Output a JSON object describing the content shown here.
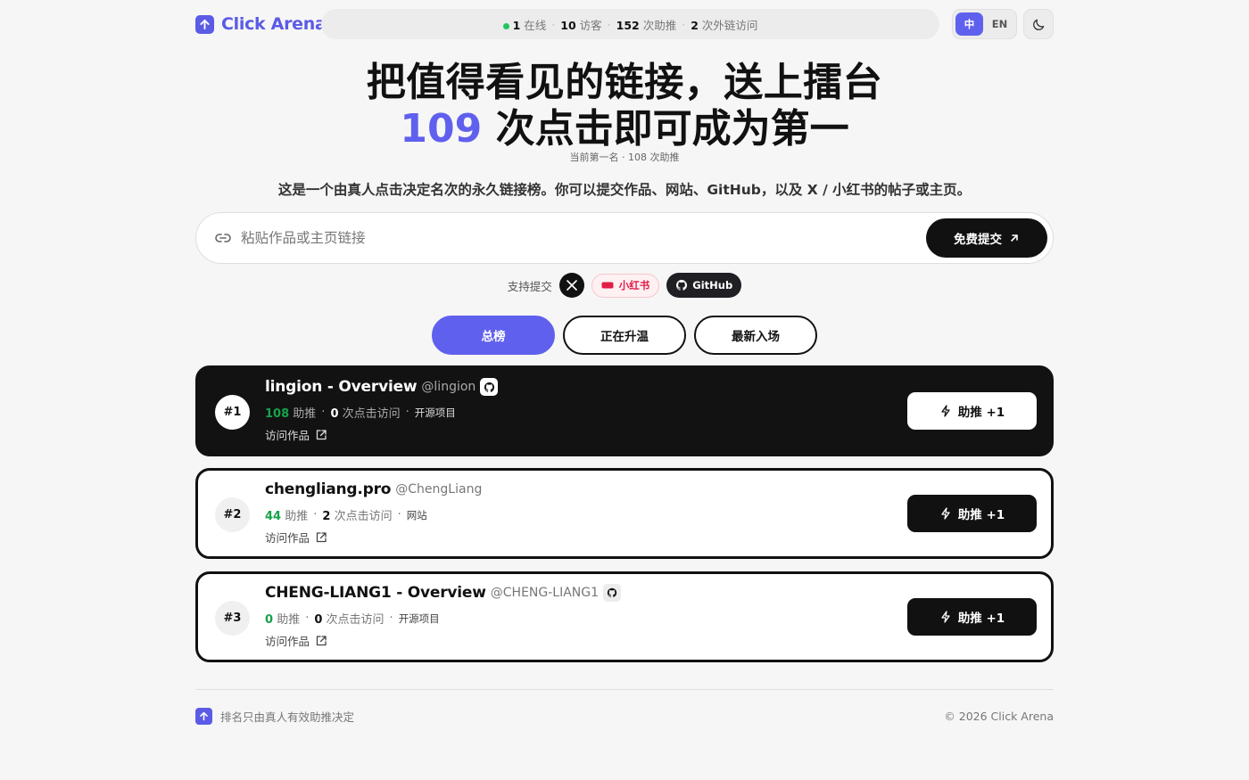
{
  "header": {
    "brand": "Click Arena",
    "stats": {
      "online_num": "1",
      "online_label": "在线",
      "visitors_num": "10",
      "visitors_label": "访客",
      "boosts_num": "152",
      "boosts_label": "次助推",
      "outbound_num": "2",
      "outbound_label": "次外链访问"
    },
    "lang": {
      "zh": "中",
      "en": "EN"
    }
  },
  "hero": {
    "line1": "把值得看见的链接，送上擂台",
    "line2_num": "109",
    "line2_text": "次点击即可成为第一",
    "sub": "当前第一名 · 108 次助推",
    "desc": "这是一个由真人点击决定名次的永久链接榜。你可以提交作品、网站、GitHub，以及 X / 小红书的帖子或主页。"
  },
  "submit": {
    "placeholder": "粘贴作品或主页链接",
    "button": "免费提交"
  },
  "support": {
    "label": "支持提交",
    "xhs_tag": "小红书",
    "github": "GitHub"
  },
  "tabs": [
    "总榜",
    "正在升温",
    "最新入场"
  ],
  "entries": [
    {
      "rank": "#1",
      "name": "lingion - Overview",
      "handle": "@lingion",
      "boosts": "108",
      "boost_label": "助推",
      "visits": "0",
      "visit_label": "次点击访问",
      "type": "开源项目",
      "visit_link": "访问作品",
      "boost_btn": "助推 +1",
      "github": true
    },
    {
      "rank": "#2",
      "name": "chengliang.pro",
      "handle": "@ChengLiang",
      "boosts": "44",
      "boost_label": "助推",
      "visits": "2",
      "visit_label": "次点击访问",
      "type": "网站",
      "visit_link": "访问作品",
      "boost_btn": "助推 +1",
      "github": false
    },
    {
      "rank": "#3",
      "name": "CHENG-LIANG1 - Overview",
      "handle": "@CHENG-LIANG1",
      "boosts": "0",
      "boost_label": "助推",
      "visits": "0",
      "visit_label": "次点击访问",
      "type": "开源项目",
      "visit_link": "访问作品",
      "boost_btn": "助推 +1",
      "github": true
    }
  ],
  "footer": {
    "left": "排名只由真人有效助推决定",
    "right": "© 2026 Click Arena"
  },
  "colors": {
    "accent": "#6060ee",
    "green": "#16a34a",
    "dark": "#121212"
  }
}
